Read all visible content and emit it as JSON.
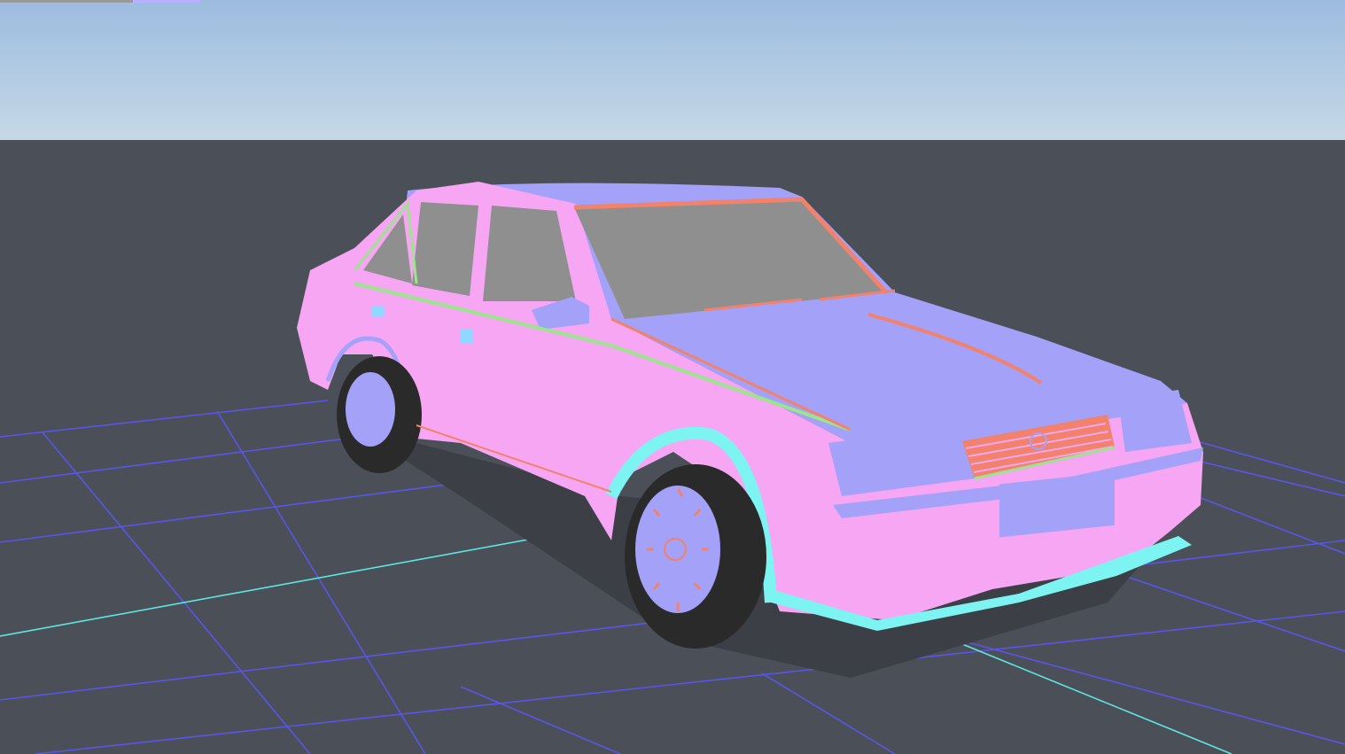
{
  "viewport": {
    "name": "3d-scene-viewport",
    "colors": {
      "sky_top": "#9dbce0",
      "sky_bottom": "#c2d7e6",
      "ground": "#4b4f58",
      "grid_line": "#5a55e8",
      "grid_axis": "#5ee6e0",
      "body_side": "#f7a6f4",
      "body_top": "#a3a1f8",
      "glass": "#8f8f8f",
      "trim_red": "#f2826c",
      "trim_green": "#9ce48e",
      "trim_cyan": "#7ef4f2",
      "tire": "#2a2a2a",
      "shadow": "#3c3f46"
    }
  },
  "tabs": {
    "left_color": "#9a9a9a",
    "right_color": "#b6b0ff"
  }
}
